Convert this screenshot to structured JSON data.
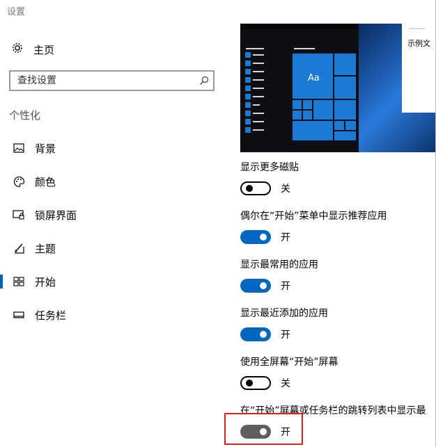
{
  "window": {
    "title": "设置"
  },
  "sidebar": {
    "home_label": "主页",
    "search_placeholder": "查找设置",
    "section_title": "个性化",
    "items": [
      {
        "label": "背景",
        "icon": "picture-icon"
      },
      {
        "label": "颜色",
        "icon": "palette-icon"
      },
      {
        "label": "锁屏界面",
        "icon": "lock-screen-icon"
      },
      {
        "label": "主题",
        "icon": "theme-brush-icon"
      },
      {
        "label": "开始",
        "icon": "start-tiles-icon",
        "selected": true
      },
      {
        "label": "任务栏",
        "icon": "taskbar-icon"
      }
    ]
  },
  "preview": {
    "tile_label": "Aa",
    "sample_text": "示例文"
  },
  "settings": [
    {
      "label": "显示更多磁贴",
      "state": "关",
      "on": false
    },
    {
      "label": "偶尔在“开始”菜单中显示推荐应用",
      "state": "开",
      "on": true
    },
    {
      "label": "显示最常用的应用",
      "state": "开",
      "on": true
    },
    {
      "label": "显示最近添加的应用",
      "state": "开",
      "on": true
    },
    {
      "label": "使用全屏幕“开始”屏幕",
      "state": "关",
      "on": false
    },
    {
      "label": "在“开始”屏幕或任务栏的跳转列表中显示最",
      "state": "开",
      "on": true
    }
  ],
  "colors": {
    "accent": "#0067c0",
    "highlight_box": "#e02020"
  }
}
